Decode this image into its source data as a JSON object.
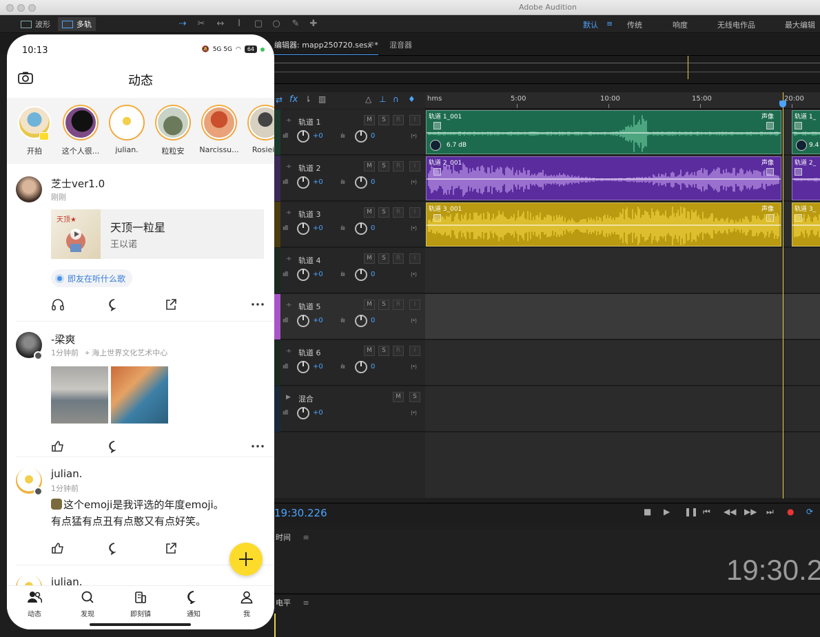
{
  "audition": {
    "app_title": "Adobe Audition",
    "mode_waveform": "波形",
    "mode_multitrack": "多轨",
    "workspaces": [
      "默认",
      "传统",
      "响度",
      "无线电作品",
      "最大编辑"
    ],
    "editor_tab": "编辑器: mapp250720.sesx *",
    "mixer_tab": "混音器",
    "ruler_labels": [
      "hms",
      "5:00",
      "10:00",
      "15:00",
      "20:00"
    ],
    "tracks": [
      {
        "name": "轨道 1",
        "volume": "+0",
        "pan": "0",
        "clip": "轨道 1_001",
        "clip2": "轨道 1_",
        "pan_label": "声像",
        "gain": "6.7 dB",
        "gain2": "9.4",
        "color": "#1d6b4e",
        "wave": "#7de0b2"
      },
      {
        "name": "轨道 2",
        "volume": "+0",
        "pan": "0",
        "clip": "轨道 2_001",
        "clip2": "轨道 2_",
        "pan_label": "声像",
        "color": "#5a2c9e",
        "wave": "#d9b3ff"
      },
      {
        "name": "轨道 3",
        "volume": "+0",
        "pan": "0",
        "clip": "轨道 3_001",
        "clip2": "轨道 3_",
        "pan_label": "声像",
        "color": "#b99a10",
        "wave": "#ffe24d"
      },
      {
        "name": "轨道 4",
        "volume": "+0",
        "pan": "0"
      },
      {
        "name": "轨道 5",
        "volume": "+0",
        "pan": "0"
      },
      {
        "name": "轨道 6",
        "volume": "+0",
        "pan": "0"
      }
    ],
    "mix_track": {
      "name": "混合",
      "volume": "+0"
    },
    "msr": [
      "M",
      "S",
      "R",
      "I"
    ],
    "current_time": "19:30.226",
    "time_panel_label": "时间",
    "big_time": "19:30.2",
    "level_panel_label": "电平"
  },
  "phone": {
    "status_time": "10:13",
    "network": "5G 5G",
    "battery": "64",
    "title": "动态",
    "stories": [
      "开拍",
      "这个人很...",
      "julian.",
      "粒粒安",
      "Narcissu...",
      "Rosieis"
    ],
    "posts": [
      {
        "user": "芝士ver1.0",
        "time": "刚刚",
        "song_title": "天顶一粒星",
        "song_artist": "王以诺",
        "tag": "即友在听什么歌"
      },
      {
        "user": "-梁爽",
        "time": "1分钟前",
        "location": "海上世界文化艺术中心"
      },
      {
        "user": "julian.",
        "time": "1分钟前",
        "text_line1": "这个emoji是我评选的年度emoji。",
        "text_line2": "有点猛有点丑有点憨又有点好笑。"
      },
      {
        "user": "julian."
      }
    ],
    "tabs": [
      "动态",
      "发现",
      "即刻镇",
      "通知",
      "我"
    ]
  }
}
